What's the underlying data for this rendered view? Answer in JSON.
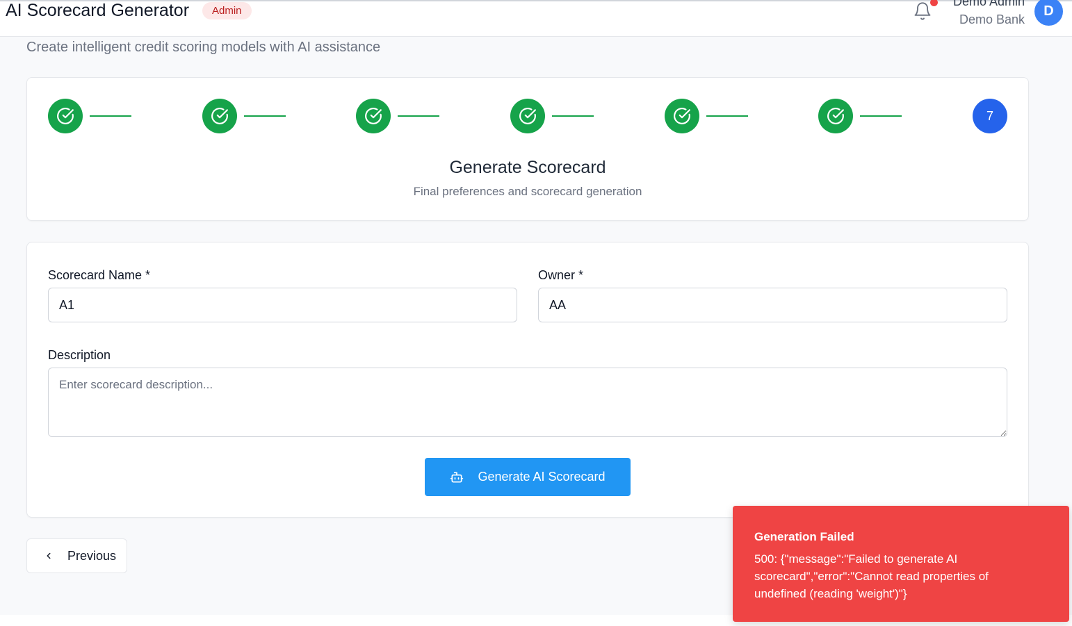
{
  "header": {
    "title": "AI Scorecard Generator",
    "role_badge": "Admin",
    "user_name": "Demo Admin",
    "user_org": "Demo Bank",
    "avatar_initial": "D"
  },
  "subtitle": "Create intelligent credit scoring models with AI assistance",
  "stepper": {
    "current_step_number": "7",
    "step_title": "Generate Scorecard",
    "step_description": "Final preferences and scorecard generation"
  },
  "form": {
    "scorecard_name_label": "Scorecard Name *",
    "scorecard_name_value": "A1",
    "owner_label": "Owner *",
    "owner_value": "AA",
    "description_label": "Description",
    "description_placeholder": "Enter scorecard description...",
    "generate_button": "Generate AI Scorecard"
  },
  "navigation": {
    "previous_button": "Previous"
  },
  "toast": {
    "title": "Generation Failed",
    "message": "500: {\"message\":\"Failed to generate AI scorecard\",\"error\":\"Cannot read properties of undefined (reading 'weight')\"}"
  },
  "colors": {
    "success": "#16a34a",
    "primary": "#2563eb",
    "button": "#2196f3",
    "error": "#ef4444"
  }
}
